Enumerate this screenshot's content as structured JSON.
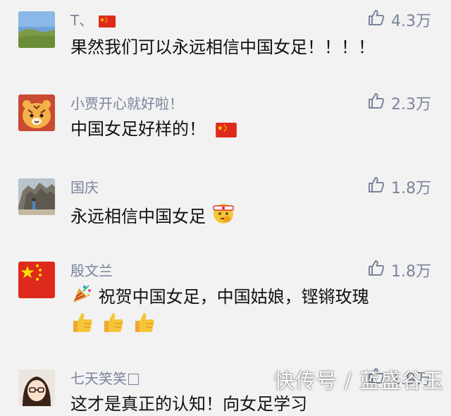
{
  "comments": [
    {
      "name": "T、",
      "likes": "4.3万",
      "text": "果然我们可以永远相信中国女足！！！！"
    },
    {
      "name": "小贾开心就好啦！",
      "likes": "2.3万",
      "text": "中国女足好样的！"
    },
    {
      "name": "国庆",
      "likes": "1.8万",
      "text": "永远相信中国女足"
    },
    {
      "name": "殷文兰",
      "likes": "1.8万",
      "text": "祝贺中国女足，中国姑娘，铿锵玫瑰"
    },
    {
      "name": "七天笑笑",
      "likes": "1.9万",
      "text": "这才是真正的认知！向女足学习"
    }
  ],
  "watermark": "快传号 / 蓝盛谷玉",
  "colors": {
    "background": "#f2f2f2",
    "name": "#7b849c",
    "text": "#111111"
  }
}
